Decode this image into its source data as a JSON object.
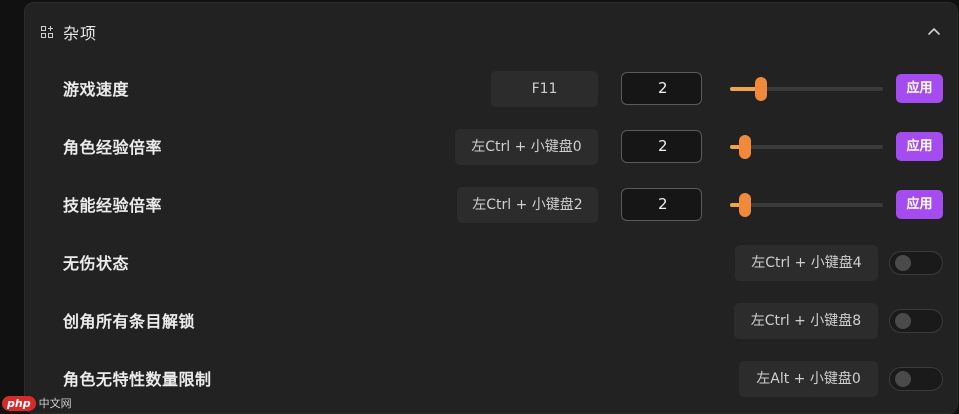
{
  "section": {
    "title": "杂项",
    "icon": "grid-plus-icon",
    "collapse_icon": "chevron-up-icon"
  },
  "rows": [
    {
      "label": "游戏速度",
      "hotkey": "F11",
      "value": "2",
      "slider_fraction": 0.2,
      "apply_label": "应用"
    },
    {
      "label": "角色经验倍率",
      "hotkey": "左Ctrl + 小键盘0",
      "value": "2",
      "slider_fraction": 0.1,
      "apply_label": "应用"
    },
    {
      "label": "技能经验倍率",
      "hotkey": "左Ctrl + 小键盘2",
      "value": "2",
      "slider_fraction": 0.1,
      "apply_label": "应用"
    },
    {
      "label": "无伤状态",
      "hotkey": "左Ctrl + 小键盘4",
      "enabled": false
    },
    {
      "label": "创角所有条目解锁",
      "hotkey": "左Ctrl + 小键盘8",
      "enabled": false
    },
    {
      "label": "角色无特性数量限制",
      "hotkey": "左Alt + 小键盘0",
      "enabled": false
    }
  ],
  "watermark": {
    "logo": "php",
    "text": "中文网"
  },
  "colors": {
    "accent_purple": "#a54cf0",
    "slider_orange": "#f08a3a",
    "panel_bg": "#222222"
  }
}
